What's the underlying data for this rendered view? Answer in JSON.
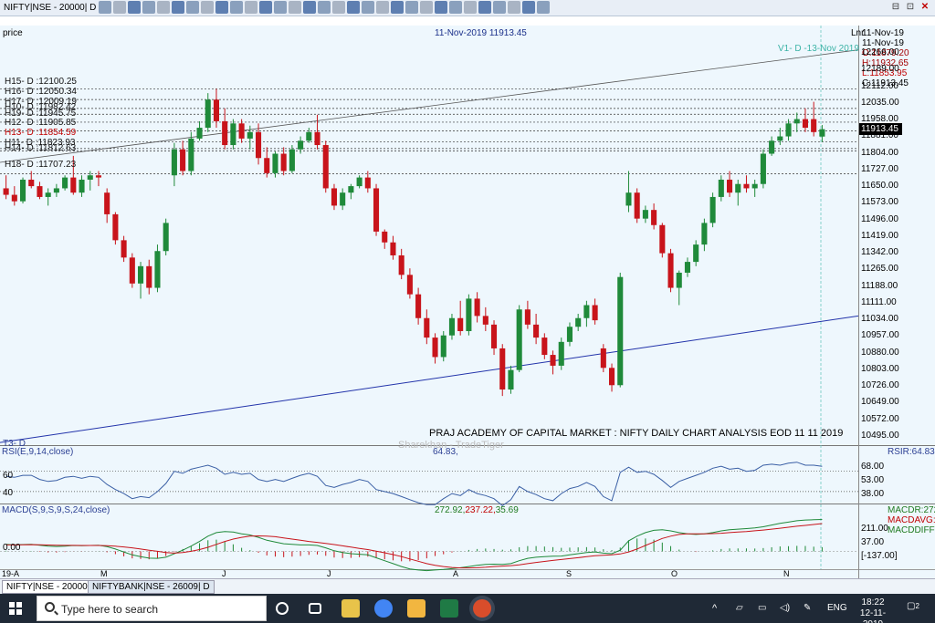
{
  "window": {
    "title": "NIFTY|NSE - 20000| D",
    "controls": [
      "⊟",
      "⊡",
      "✕"
    ]
  },
  "chart_header": {
    "price_label": "price",
    "date_price": "11-Nov-2019 11913.45",
    "scale_label": "Lnr",
    "v1_label": "V1- D -13-Nov 2019"
  },
  "info_box": {
    "date1": "11-Nov-19",
    "date2": "11-Nov-19",
    "open": "O:11879.20",
    "high": "H:11932.65",
    "low": "L:11853.95",
    "close": "C:11913.45"
  },
  "price_axis": [
    "12266.00",
    "12189.00",
    "12112.00",
    "12035.00",
    "11958.00",
    "11881.00",
    "11804.00",
    "11727.00",
    "11650.00",
    "11573.00",
    "11496.00",
    "11419.00",
    "11342.00",
    "11265.00",
    "11188.00",
    "11111.00",
    "11034.00",
    "10957.00",
    "10880.00",
    "10803.00",
    "10726.00",
    "10649.00",
    "10572.00",
    "10495.00"
  ],
  "current_price": "11913.45",
  "levels": [
    {
      "label": "H15- D :12100.25",
      "value": 12100.25,
      "red": false
    },
    {
      "label": "H16- D :12050.34",
      "value": 12050.34,
      "red": false
    },
    {
      "label": "H17- D :12009.19",
      "value": 12009.19,
      "red": false
    },
    {
      "label": "H10- D :11982.42",
      "value": 11982.42,
      "red": false
    },
    {
      "label": "H19- D :11945.75",
      "value": 11945.75,
      "red": false
    },
    {
      "label": "H12- D :11905.85",
      "value": 11905.85,
      "red": false
    },
    {
      "label": "H13- D :11854.59",
      "value": 11854.59,
      "red": true
    },
    {
      "label": "H11- D :11823.93",
      "value": 11823.93,
      "red": false
    },
    {
      "label": "H14- D :11812.63",
      "value": 11812.63,
      "red": false
    },
    {
      "label": "H18- D :11707.23",
      "value": 11707.23,
      "red": false
    }
  ],
  "caption": "PRAJ ACADEMY OF CAPITAL MARKET : NIFTY DAILY CHART ANALYSIS EOD 11 11 2019",
  "watermark": "Sharekhan - TradeTiger",
  "t3_label": "T3- D",
  "rsi": {
    "title": "RSI(E,9,14,close)",
    "value": "64.83,",
    "right_label": "RSIR:64.83",
    "level_60": "60",
    "level_40": "40",
    "ticks": [
      "68.00",
      "53.00",
      "38.00"
    ]
  },
  "macd": {
    "title": "MACD(S,9,S,9,S,24,close)",
    "v1": "272.92,",
    "v2": "237.22,",
    "v3": "35.69",
    "zero": "0.00",
    "ticks": [
      "211.00",
      "37.00",
      "[-137.00]"
    ],
    "legend": [
      "MACDR:272",
      "MACDAVG:",
      "MACDDIFF:"
    ]
  },
  "x_axis": [
    "19-A",
    "M",
    "J",
    "J",
    "A",
    "S",
    "O",
    "N"
  ],
  "tabs": [
    "NIFTY|NSE - 20000| D",
    "NIFTYBANK|NSE - 26009| D"
  ],
  "taskbar": {
    "search_placeholder": "Type here to search",
    "lang": "ENG",
    "time": "18:22",
    "date": "12-11-2019",
    "notifications": "2"
  },
  "chart_data": {
    "type": "candlestick",
    "title": "11-Nov-2019 11913.45",
    "ylim": [
      10495,
      12266
    ],
    "x_axis_labels": [
      "19-A",
      "M",
      "J",
      "J",
      "A",
      "S",
      "O",
      "N"
    ],
    "candles": [
      [
        11640,
        11700,
        11590,
        11610
      ],
      [
        11610,
        11650,
        11560,
        11580
      ],
      [
        11580,
        11690,
        11570,
        11680
      ],
      [
        11680,
        11720,
        11640,
        11650
      ],
      [
        11650,
        11670,
        11590,
        11600
      ],
      [
        11600,
        11640,
        11560,
        11620
      ],
      [
        11620,
        11660,
        11600,
        11640
      ],
      [
        11640,
        11700,
        11630,
        11690
      ],
      [
        11690,
        11790,
        11610,
        11620
      ],
      [
        11620,
        11700,
        11600,
        11680
      ],
      [
        11680,
        11720,
        11630,
        11700
      ],
      [
        11700,
        11720,
        11650,
        11690
      ],
      [
        11620,
        11640,
        11480,
        11520
      ],
      [
        11520,
        11530,
        11380,
        11400
      ],
      [
        11400,
        11420,
        11300,
        11320
      ],
      [
        11320,
        11340,
        11180,
        11200
      ],
      [
        11200,
        11300,
        11130,
        11280
      ],
      [
        11280,
        11310,
        11150,
        11180
      ],
      [
        11180,
        11380,
        11160,
        11350
      ],
      [
        11350,
        11500,
        11330,
        11480
      ],
      [
        11700,
        11850,
        11650,
        11820
      ],
      [
        11820,
        11860,
        11700,
        11720
      ],
      [
        11720,
        11900,
        11700,
        11870
      ],
      [
        11870,
        11950,
        11860,
        11920
      ],
      [
        11920,
        12080,
        11900,
        12050
      ],
      [
        12050,
        12100,
        11920,
        11950
      ],
      [
        11950,
        12010,
        11820,
        11840
      ],
      [
        11840,
        11960,
        11820,
        11940
      ],
      [
        11940,
        11960,
        11850,
        11870
      ],
      [
        11870,
        11930,
        11820,
        11900
      ],
      [
        11900,
        11940,
        11750,
        11780
      ],
      [
        11780,
        11830,
        11690,
        11710
      ],
      [
        11710,
        11810,
        11690,
        11800
      ],
      [
        11800,
        11830,
        11700,
        11720
      ],
      [
        11720,
        11840,
        11710,
        11820
      ],
      [
        11820,
        11880,
        11800,
        11860
      ],
      [
        11860,
        11920,
        11850,
        11900
      ],
      [
        11900,
        11980,
        11820,
        11840
      ],
      [
        11840,
        11860,
        11620,
        11640
      ],
      [
        11640,
        11660,
        11540,
        11560
      ],
      [
        11560,
        11640,
        11540,
        11620
      ],
      [
        11620,
        11660,
        11590,
        11650
      ],
      [
        11650,
        11700,
        11640,
        11690
      ],
      [
        11690,
        11720,
        11620,
        11640
      ],
      [
        11640,
        11660,
        11420,
        11440
      ],
      [
        11440,
        11450,
        11360,
        11390
      ],
      [
        11390,
        11420,
        11310,
        11330
      ],
      [
        11330,
        11360,
        11220,
        11240
      ],
      [
        11240,
        11270,
        11130,
        11150
      ],
      [
        11150,
        11180,
        11010,
        11040
      ],
      [
        11040,
        11080,
        10920,
        10950
      ],
      [
        10950,
        10970,
        10830,
        10860
      ],
      [
        10860,
        10980,
        10840,
        10960
      ],
      [
        10960,
        11060,
        10940,
        11040
      ],
      [
        11040,
        11120,
        10960,
        10980
      ],
      [
        10980,
        11150,
        10960,
        11130
      ],
      [
        11130,
        11160,
        11020,
        11050
      ],
      [
        11050,
        11090,
        10980,
        11010
      ],
      [
        11010,
        11030,
        10870,
        10900
      ],
      [
        10900,
        10920,
        10680,
        10710
      ],
      [
        10710,
        10820,
        10690,
        10800
      ],
      [
        10800,
        11100,
        10790,
        11080
      ],
      [
        11080,
        11120,
        10990,
        11010
      ],
      [
        11010,
        11060,
        10920,
        10950
      ],
      [
        10950,
        10970,
        10850,
        10870
      ],
      [
        10870,
        10890,
        10780,
        10820
      ],
      [
        10820,
        10950,
        10800,
        10930
      ],
      [
        10930,
        11020,
        10910,
        11000
      ],
      [
        11000,
        11060,
        10980,
        11040
      ],
      [
        11040,
        11120,
        11000,
        11100
      ],
      [
        11100,
        11130,
        11010,
        11030
      ],
      [
        10900,
        10920,
        10790,
        10810
      ],
      [
        10810,
        10830,
        10700,
        10730
      ],
      [
        10730,
        11250,
        10720,
        11230
      ],
      [
        11560,
        11720,
        11530,
        11620
      ],
      [
        11620,
        11640,
        11480,
        11500
      ],
      [
        11500,
        11560,
        11480,
        11540
      ],
      [
        11540,
        11570,
        11450,
        11470
      ],
      [
        11470,
        11480,
        11320,
        11340
      ],
      [
        11340,
        11360,
        11160,
        11180
      ],
      [
        11180,
        11260,
        11100,
        11250
      ],
      [
        11250,
        11320,
        11230,
        11300
      ],
      [
        11300,
        11400,
        11280,
        11380
      ],
      [
        11380,
        11500,
        11350,
        11480
      ],
      [
        11480,
        11620,
        11460,
        11600
      ],
      [
        11600,
        11700,
        11580,
        11680
      ],
      [
        11680,
        11720,
        11600,
        11620
      ],
      [
        11620,
        11680,
        11560,
        11660
      ],
      [
        11660,
        11700,
        11620,
        11640
      ],
      [
        11640,
        11680,
        11600,
        11660
      ],
      [
        11660,
        11820,
        11640,
        11800
      ],
      [
        11800,
        11880,
        11790,
        11860
      ],
      [
        11860,
        11920,
        11840,
        11880
      ],
      [
        11880,
        11960,
        11860,
        11940
      ],
      [
        11940,
        11990,
        11900,
        11960
      ],
      [
        11960,
        12010,
        11900,
        11920
      ],
      [
        11960,
        12040,
        11880,
        11900
      ],
      [
        11879.2,
        11932.65,
        11853.95,
        11913.45
      ]
    ],
    "rsi_range": [
      30,
      75
    ],
    "rsi": [
      55,
      54,
      56,
      56,
      52,
      50,
      51,
      54,
      55,
      53,
      55,
      54,
      47,
      42,
      38,
      33,
      35,
      34,
      40,
      48,
      60,
      58,
      62,
      64,
      66,
      63,
      57,
      59,
      57,
      58,
      52,
      50,
      52,
      50,
      53,
      56,
      58,
      55,
      46,
      44,
      47,
      49,
      52,
      50,
      42,
      40,
      38,
      35,
      32,
      29,
      27,
      27,
      33,
      38,
      36,
      42,
      38,
      36,
      33,
      26,
      32,
      45,
      40,
      37,
      33,
      31,
      38,
      43,
      45,
      49,
      45,
      35,
      31,
      59,
      64,
      59,
      60,
      57,
      51,
      44,
      50,
      53,
      56,
      59,
      63,
      65,
      62,
      63,
      60,
      61,
      66,
      67,
      66,
      68,
      69,
      66,
      66,
      64.83
    ],
    "macd_range": [
      -137,
      300
    ],
    "macd_line": [
      60,
      55,
      58,
      60,
      52,
      45,
      42,
      45,
      50,
      48,
      50,
      52,
      40,
      20,
      -5,
      -30,
      -45,
      -58,
      -60,
      -50,
      -20,
      10,
      45,
      85,
      130,
      160,
      170,
      165,
      150,
      140,
      120,
      95,
      80,
      65,
      60,
      55,
      55,
      50,
      30,
      5,
      -10,
      -20,
      -25,
      -30,
      -55,
      -80,
      -105,
      -130,
      -150,
      -160,
      -165,
      -160,
      -155,
      -148,
      -140,
      -130,
      -120,
      -112,
      -110,
      -112,
      -105,
      -80,
      -60,
      -50,
      -45,
      -42,
      -40,
      -30,
      -20,
      -10,
      -5,
      -15,
      -20,
      10,
      90,
      130,
      160,
      180,
      185,
      175,
      160,
      150,
      145,
      150,
      160,
      175,
      185,
      190,
      195,
      200,
      210,
      225,
      240,
      250,
      262,
      268,
      270,
      272.92
    ],
    "macd_signal": [
      55,
      55,
      56,
      57,
      56,
      54,
      52,
      51,
      51,
      50,
      50,
      50,
      48,
      44,
      38,
      30,
      20,
      10,
      0,
      -10,
      -15,
      -10,
      0,
      15,
      35,
      60,
      85,
      105,
      120,
      130,
      132,
      130,
      125,
      115,
      105,
      95,
      85,
      77,
      68,
      58,
      47,
      36,
      25,
      15,
      2,
      -12,
      -28,
      -45,
      -65,
      -85,
      -105,
      -120,
      -130,
      -138,
      -142,
      -142,
      -140,
      -136,
      -130,
      -126,
      -122,
      -115,
      -105,
      -95,
      -86,
      -78,
      -70,
      -62,
      -54,
      -46,
      -38,
      -33,
      -30,
      -22,
      -5,
      20,
      50,
      80,
      110,
      130,
      145,
      150,
      150,
      150,
      152,
      155,
      160,
      165,
      170,
      176,
      182,
      190,
      198,
      206,
      215,
      222,
      230,
      237.22
    ],
    "macd_hist": [
      5,
      0,
      2,
      3,
      -4,
      -9,
      -10,
      -6,
      -1,
      -2,
      0,
      2,
      -8,
      -24,
      -43,
      -60,
      -65,
      -68,
      -60,
      -40,
      -5,
      20,
      45,
      70,
      95,
      100,
      85,
      60,
      30,
      10,
      -12,
      -35,
      -45,
      -50,
      -45,
      -40,
      -30,
      -27,
      -38,
      -53,
      -57,
      -56,
      -50,
      -45,
      -57,
      -68,
      -77,
      -85,
      -85,
      -75,
      -60,
      -40,
      -25,
      -10,
      2,
      12,
      20,
      24,
      20,
      14,
      17,
      35,
      45,
      45,
      41,
      36,
      30,
      32,
      34,
      36,
      33,
      18,
      10,
      32,
      95,
      110,
      110,
      100,
      75,
      45,
      15,
      0,
      -5,
      0,
      8,
      20,
      25,
      25,
      25,
      24,
      28,
      35,
      42,
      44,
      47,
      46,
      40,
      35.69
    ]
  }
}
